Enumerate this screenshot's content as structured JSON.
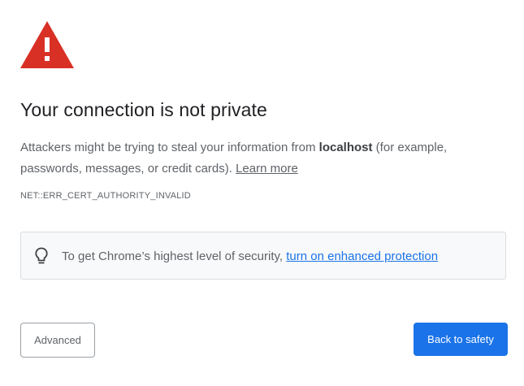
{
  "icons": {
    "warning": "warning-triangle-icon",
    "tip": "lightbulb-icon"
  },
  "colors": {
    "warning_red": "#d93025",
    "primary_blue": "#1a73e8",
    "text_secondary": "#5f6368",
    "box_background": "#f8f9fa"
  },
  "interstitial": {
    "title": "Your connection is not private",
    "explanation": {
      "before_host": "Attackers might be trying to steal your information from ",
      "host": "localhost",
      "after_host": " (for example, passwords, messages, or credit cards). ",
      "learn_more_link": "Learn more"
    },
    "error_code": "NET::ERR_CERT_AUTHORITY_INVALID",
    "enhanced_protection": {
      "text": "To get Chrome’s highest level of security, ",
      "link": "turn on enhanced protection"
    },
    "buttons": {
      "advanced": "Advanced",
      "back_to_safety": "Back to safety"
    }
  }
}
